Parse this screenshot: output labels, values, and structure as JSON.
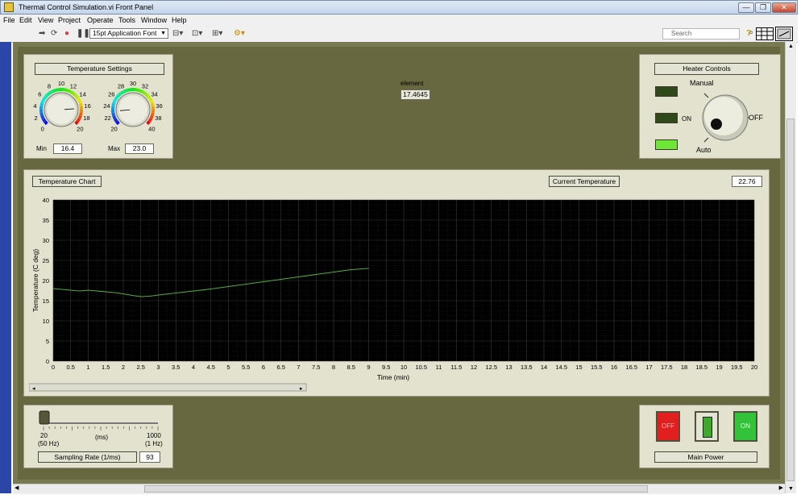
{
  "window": {
    "title": "Thermal Control Simulation.vi Front Panel",
    "btn_min": "—",
    "btn_max": "❐",
    "btn_close": "✕"
  },
  "menu": [
    "File",
    "Edit",
    "View",
    "Project",
    "Operate",
    "Tools",
    "Window",
    "Help"
  ],
  "toolbar": {
    "font": "15pt Application Font",
    "search_placeholder": "Search",
    "help": "?"
  },
  "temperature_settings": {
    "label": "Temperature Settings",
    "min_label": "Min",
    "min_value": "16.4",
    "max_label": "Max",
    "max_value": "23.0",
    "min_knob_scale": [
      "0",
      "2",
      "4",
      "6",
      "8",
      "10",
      "12",
      "14",
      "16",
      "18",
      "20"
    ],
    "max_knob_scale": [
      "20",
      "22",
      "24",
      "26",
      "28",
      "30",
      "32",
      "34",
      "36",
      "38",
      "40"
    ],
    "min_knob_value": 16.4,
    "max_knob_value": 23.0
  },
  "element": {
    "label": "element",
    "value": "17.4645"
  },
  "heater_controls": {
    "label": "Heater Controls",
    "on_label": "ON",
    "knob_manual": "Manual",
    "knob_off": "OFF",
    "knob_auto": "Auto",
    "selected": "Auto"
  },
  "temperature_chart": {
    "label": "Temperature Chart"
  },
  "current_temperature": {
    "label": "Current Temperature",
    "value": "22.76"
  },
  "chart_data": {
    "type": "line",
    "xlabel": "Time (min)",
    "ylabel": "Temperature (C deg)",
    "xlim": [
      0,
      20
    ],
    "ylim": [
      0,
      40
    ],
    "x_ticks": [
      "0",
      "0.5",
      "1",
      "1.5",
      "2",
      "2.5",
      "3",
      "3.5",
      "4",
      "4.5",
      "5",
      "5.5",
      "6",
      "6.5",
      "7",
      "7.5",
      "8",
      "8.5",
      "9",
      "9.5",
      "10",
      "10.5",
      "11",
      "11.5",
      "12",
      "12.5",
      "13",
      "13.5",
      "14",
      "14.5",
      "15",
      "15.5",
      "16",
      "16.5",
      "17",
      "17.5",
      "18",
      "18.5",
      "19",
      "19.5",
      "20"
    ],
    "y_ticks": [
      "0",
      "5",
      "10",
      "15",
      "20",
      "25",
      "30",
      "35",
      "40"
    ],
    "grid": true,
    "series": [
      {
        "color": "#4fae3c",
        "x": [
          0,
          0.25,
          0.5,
          0.75,
          1,
          1.25,
          1.5,
          1.75,
          2,
          2.25,
          2.5,
          2.75,
          3,
          3.5,
          4,
          4.5,
          5,
          5.5,
          6,
          6.5,
          7,
          7.5,
          8,
          8.5,
          9
        ],
        "y": [
          18,
          17.8,
          17.6,
          17.4,
          17.6,
          17.4,
          17.2,
          17.0,
          16.7,
          16.3,
          16.0,
          16.1,
          16.4,
          16.9,
          17.4,
          17.9,
          18.5,
          19.1,
          19.7,
          20.3,
          20.9,
          21.5,
          22.1,
          22.7,
          23.0
        ]
      }
    ]
  },
  "sampling": {
    "label": "Sampling Rate (1/ms)",
    "value": "93",
    "scale_min": "20",
    "scale_max": "1000",
    "unit": "(ms)",
    "min_hz": "(50 Hz)",
    "max_hz": "(1 Hz)",
    "slider_value": 20
  },
  "main_power": {
    "label": "Main Power",
    "off": "OFF",
    "on": "ON"
  },
  "colors": {
    "panel": "#67683f",
    "frame": "#e2e2ce",
    "plot_bg": "#000000",
    "trace": "#4fae3c",
    "led_on": "#6fe636",
    "led_off": "#2f4a18"
  }
}
